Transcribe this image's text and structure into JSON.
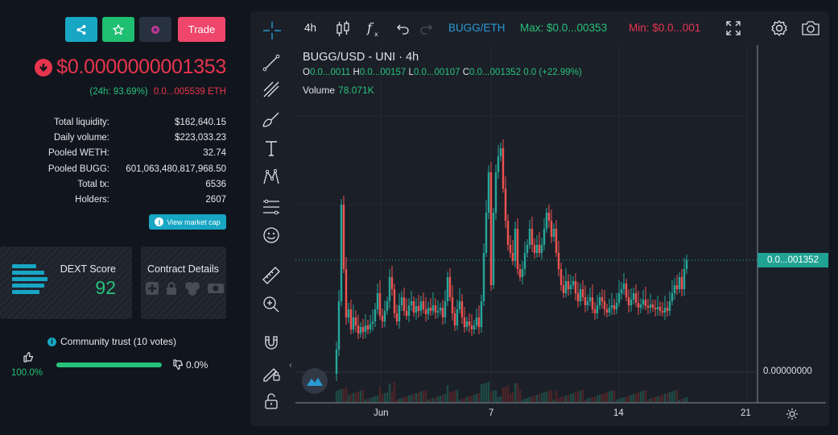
{
  "token": {
    "buttons": {
      "trade_label": "Trade"
    },
    "price": "$0.0000000001353",
    "change_24h": "(24h: 93.69%)",
    "change_eth": "0.0...005539 ETH",
    "stats": [
      {
        "label": "Total liquidity:",
        "value": "$162,640.15"
      },
      {
        "label": "Daily volume:",
        "value": "$223,033.23"
      },
      {
        "label": "Pooled WETH:",
        "value": "32.74"
      },
      {
        "label": "Pooled BUGG:",
        "value": "601,063,480,817,968.50"
      },
      {
        "label": "Total tx:",
        "value": "6536"
      },
      {
        "label": "Holders:",
        "value": "2607"
      }
    ],
    "view_market_cap": "View market cap",
    "dext_score_title": "DEXT Score",
    "dext_score": "92",
    "contract_details": "Contract Details",
    "community_trust": "Community trust (10 votes)",
    "trust_up_pct": "100.0%",
    "trust_down_pct": "0.0%"
  },
  "chart": {
    "interval": "4h",
    "pair": "BUGG/ETH",
    "max": "Max: $0.0...00353",
    "min": "Min: $0.0...001",
    "title": "BUGG/USD - UNI · 4h",
    "ohlc": {
      "o": "0.0...0011",
      "h": "0.0...00157",
      "l": "0.0...00107",
      "c": "0.0...001352",
      "change": "0.0 (+22.99%)"
    },
    "volume_label": "Volume",
    "volume_value": "78.071K",
    "last_price_tag": "0.0...001352",
    "zero_label": "0.00000000",
    "x_labels": [
      "Jun",
      "7",
      "14",
      "21"
    ],
    "colors": {
      "up": "#26a69a",
      "down": "#ef5350",
      "accent": "#2a9bd5"
    }
  }
}
